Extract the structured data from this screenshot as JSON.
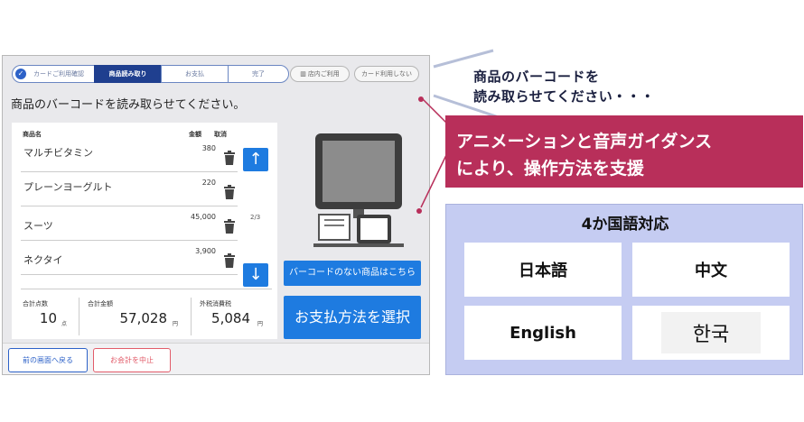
{
  "steps": [
    {
      "label": "カードご利用確認",
      "state": "done"
    },
    {
      "label": "商品読み取り",
      "state": "active"
    },
    {
      "label": "お支払",
      "state": "todo"
    },
    {
      "label": "完了",
      "state": "todo"
    }
  ],
  "pills": {
    "store_use": "店内ご利用",
    "card_none": "カード利用しない"
  },
  "instruction": "商品のバーコードを読み取らせてください。",
  "table": {
    "headers": {
      "name": "商品名",
      "price": "金額",
      "cancel": "取消"
    },
    "rows": [
      {
        "name": "マルチビタミン",
        "price": "380"
      },
      {
        "name": "プレーンヨーグルト",
        "price": "220"
      },
      {
        "name": "スーツ",
        "price": "45,000"
      },
      {
        "name": "ネクタイ",
        "price": "3,900"
      }
    ],
    "page": "2/3",
    "up_arrow": "↑",
    "down_arrow": "↓"
  },
  "totals": {
    "count_label": "合計点数",
    "count_value": "10",
    "count_unit": "点",
    "amount_label": "合計金額",
    "amount_value": "57,028",
    "amount_unit": "円",
    "tax_label": "外税消費税",
    "tax_value": "5,084",
    "tax_unit": "円"
  },
  "buttons": {
    "no_barcode": "バーコードのない商品はこちら",
    "pay_method": "お支払方法を選択",
    "back": "前の画面へ戻る",
    "cancel_checkout": "お会計を中止"
  },
  "callout": {
    "line1": "商品のバーコードを",
    "line2": "読み取らせてください・・・"
  },
  "banner": {
    "line1": "アニメーションと音声ガイダンス",
    "line2": "により、操作方法を支援"
  },
  "languages": {
    "title": "4か国語対応",
    "items": [
      "日本語",
      "中文",
      "English",
      "한국"
    ]
  },
  "colors": {
    "accent_blue": "#1e7be0",
    "banner_red": "#b82f5a",
    "lang_bg": "#c5ccf2",
    "step_active": "#1f3f8f"
  }
}
